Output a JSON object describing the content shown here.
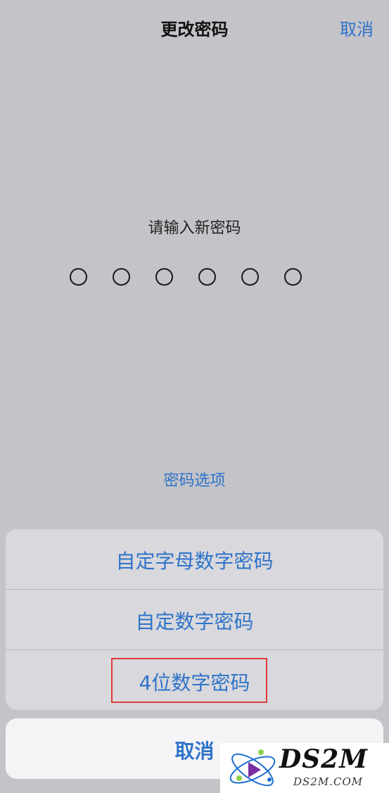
{
  "nav": {
    "title": "更改密码",
    "cancel": "取消"
  },
  "passcode": {
    "prompt": "请输入新密码",
    "length": 6,
    "entered": 0
  },
  "options_link": "密码选项",
  "action_sheet": {
    "items": [
      {
        "label": "自定字母数字密码"
      },
      {
        "label": "自定数字密码"
      },
      {
        "label": "4位数字密码"
      }
    ],
    "cancel": "取消"
  },
  "watermark": {
    "brand": "DS2M",
    "domain": "DS2M.COM"
  },
  "colors": {
    "background": "#c3c3c8",
    "accent": "#2f73c9",
    "highlight": "#e03a3a"
  }
}
